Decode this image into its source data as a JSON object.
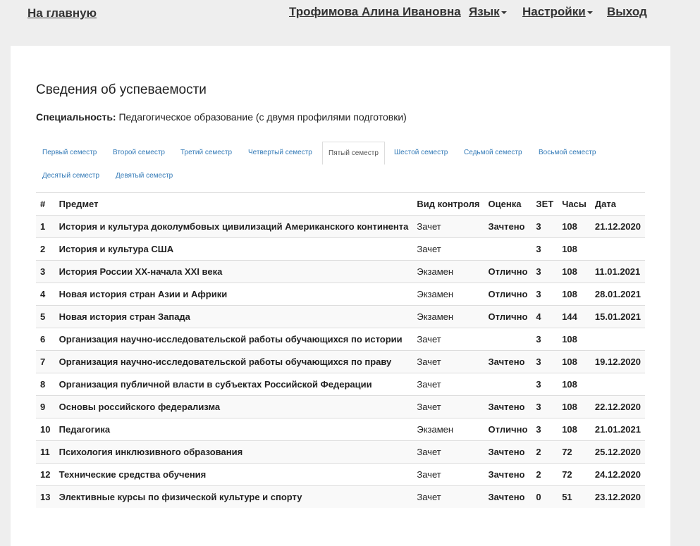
{
  "nav": {
    "home": "На главную",
    "user": "Трофимова Алина Ивановна",
    "language": "Язык",
    "settings": "Настройки",
    "logout": "Выход"
  },
  "page": {
    "title": "Сведения об успеваемости",
    "specialty_label": "Специальность:",
    "specialty_value": "Педагогическое образование (с двумя профилями подготовки)"
  },
  "tabs": [
    "Первый семестр",
    "Второй семестр",
    "Третий семестр",
    "Четвертый семестр",
    "Пятый семестр",
    "Шестой семестр",
    "Седьмой семестр",
    "Восьмой семестр",
    "Десятый семестр",
    "Девятый семестр"
  ],
  "active_tab": "Пятый семестр",
  "table": {
    "headers": [
      "#",
      "Предмет",
      "Вид контроля",
      "Оценка",
      "ЗЕТ",
      "Часы",
      "Дата"
    ],
    "rows": [
      [
        "1",
        "История и культура доколумбовых цивилизаций Американского континента",
        "Зачет",
        "Зачтено",
        "3",
        "108",
        "21.12.2020"
      ],
      [
        "2",
        "История и культура США",
        "Зачет",
        "",
        "3",
        "108",
        ""
      ],
      [
        "3",
        "История России XX-начала XXI века",
        "Экзамен",
        "Отлично",
        "3",
        "108",
        "11.01.2021"
      ],
      [
        "4",
        "Новая история стран Азии и Африки",
        "Экзамен",
        "Отлично",
        "3",
        "108",
        "28.01.2021"
      ],
      [
        "5",
        "Новая история стран Запада",
        "Экзамен",
        "Отлично",
        "4",
        "144",
        "15.01.2021"
      ],
      [
        "6",
        "Организация научно-исследовательской работы обучающихся по истории",
        "Зачет",
        "",
        "3",
        "108",
        ""
      ],
      [
        "7",
        "Организация научно-исследовательской работы обучающихся по праву",
        "Зачет",
        "Зачтено",
        "3",
        "108",
        "19.12.2020"
      ],
      [
        "8",
        "Организация публичной власти в субъектах Российской Федерации",
        "Зачет",
        "",
        "3",
        "108",
        ""
      ],
      [
        "9",
        "Основы российского федерализма",
        "Зачет",
        "Зачтено",
        "3",
        "108",
        "22.12.2020"
      ],
      [
        "10",
        "Педагогика",
        "Экзамен",
        "Отлично",
        "3",
        "108",
        "21.01.2021"
      ],
      [
        "11",
        "Психология инклюзивного образования",
        "Зачет",
        "Зачтено",
        "2",
        "72",
        "25.12.2020"
      ],
      [
        "12",
        "Технические средства обучения",
        "Зачет",
        "Зачтено",
        "2",
        "72",
        "24.12.2020"
      ],
      [
        "13",
        "Элективные курсы по физической культуре и спорту",
        "Зачет",
        "Зачтено",
        "0",
        "51",
        "23.12.2020"
      ]
    ]
  }
}
